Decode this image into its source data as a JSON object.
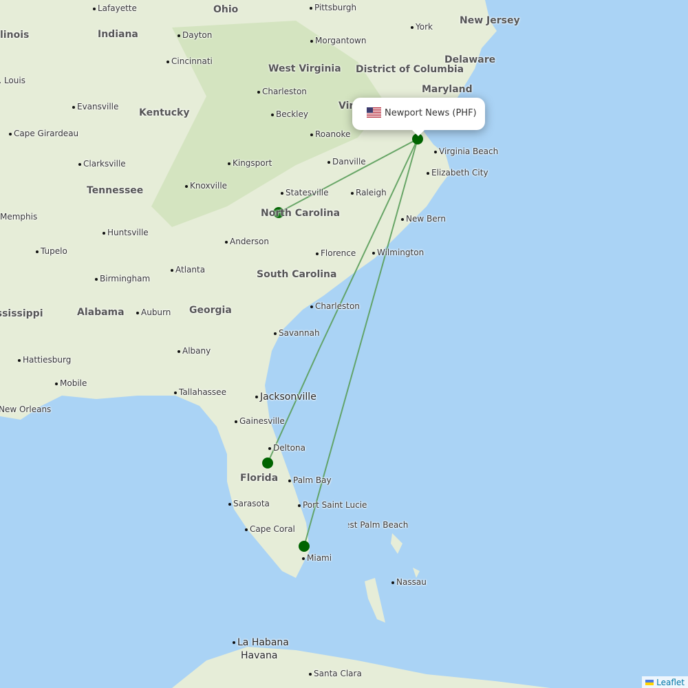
{
  "popup": {
    "title": "Newport News (PHF)",
    "flag_icon": "us-flag-icon"
  },
  "attribution": {
    "label": "Leaflet"
  },
  "colors": {
    "ocean": "#aad3f5",
    "land": "#e4ecd6",
    "route": "#5a9e5a",
    "marker": "#006400"
  },
  "states": [
    "Ohio",
    "Illinois",
    "Indiana",
    "West Virginia",
    "District of Columbia",
    "New Jersey",
    "Delaware",
    "Maryland",
    "Kentucky",
    "Virginia",
    "Tennessee",
    "North Carolina",
    "South Carolina",
    "Georgia",
    "Alabama",
    "Mississippi",
    "Florida"
  ],
  "cities": [
    "Lafayette",
    "Pittsburgh",
    "Dayton",
    "Morgantown",
    "York",
    "Cincinnati",
    "St. Louis",
    "Charleston",
    "Evansville",
    "Beckley",
    "Cape Girardeau",
    "Roanoke",
    "Virginia Beach",
    "Clarksville",
    "Kingsport",
    "Danville",
    "Elizabeth City",
    "Knoxville",
    "Statesville",
    "Raleigh",
    "Memphis",
    "New Bern",
    "Huntsville",
    "Anderson",
    "Tupelo",
    "Florence",
    "Wilmington",
    "Atlanta",
    "Birmingham",
    "Charleston",
    "Auburn",
    "Savannah",
    "Hattiesburg",
    "Albany",
    "Mobile",
    "Tallahassee",
    "Jacksonville",
    "New Orleans",
    "Gainesville",
    "Deltona",
    "Palm Bay",
    "Sarasota",
    "Port Saint Lucie",
    "West Palm Beach",
    "Cape Coral",
    "Miami",
    "Nassau",
    "La Habana",
    "Havana",
    "Santa Clara",
    "Memphis"
  ]
}
